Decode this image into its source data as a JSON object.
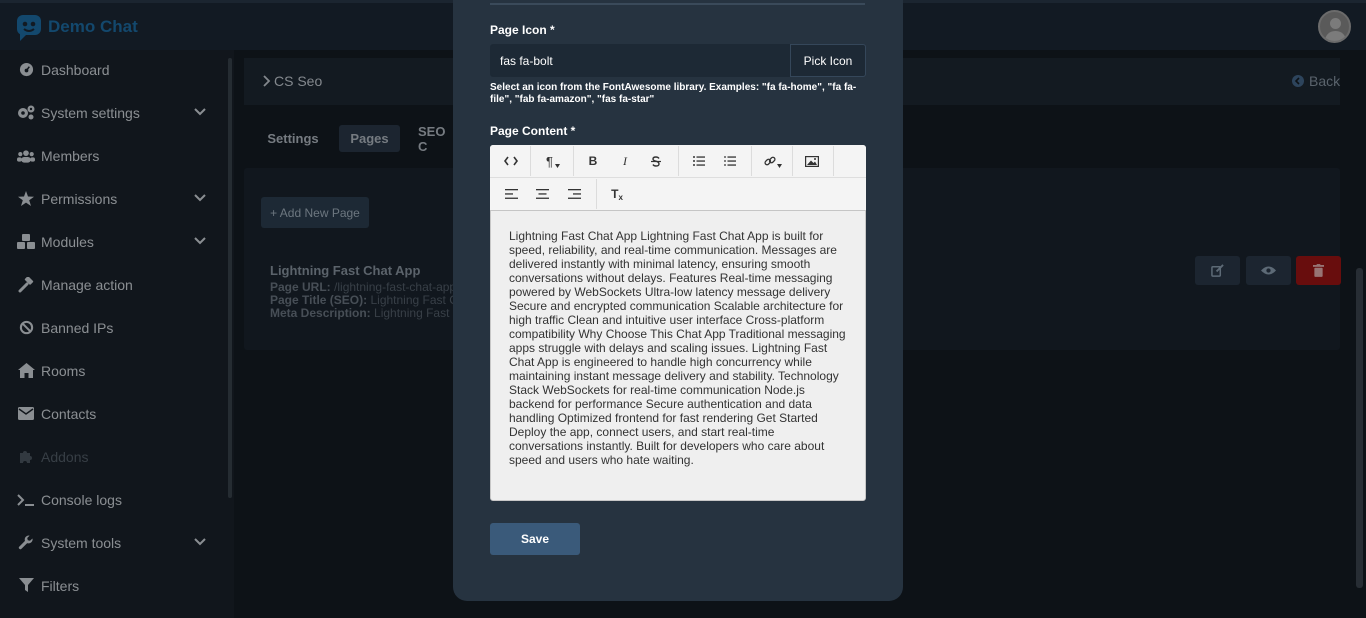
{
  "brand": {
    "name": "Demo Chat"
  },
  "sidebar": {
    "items": [
      {
        "label": "Dashboard",
        "icon": "dashboard-icon",
        "chevron": false,
        "dim": false
      },
      {
        "label": "System settings",
        "icon": "gears-icon",
        "chevron": true,
        "dim": false
      },
      {
        "label": "Members",
        "icon": "users-icon",
        "chevron": false,
        "dim": false
      },
      {
        "label": "Permissions",
        "icon": "star-icon",
        "chevron": true,
        "dim": false
      },
      {
        "label": "Modules",
        "icon": "cubes-icon",
        "chevron": true,
        "dim": false
      },
      {
        "label": "Manage action",
        "icon": "hammer-icon",
        "chevron": false,
        "dim": false
      },
      {
        "label": "Banned IPs",
        "icon": "ban-icon",
        "chevron": false,
        "dim": false
      },
      {
        "label": "Rooms",
        "icon": "home-icon",
        "chevron": false,
        "dim": false
      },
      {
        "label": "Contacts",
        "icon": "envelope-icon",
        "chevron": false,
        "dim": false
      },
      {
        "label": "Addons",
        "icon": "puzzle-icon",
        "chevron": false,
        "dim": true
      },
      {
        "label": "Console logs",
        "icon": "terminal-icon",
        "chevron": false,
        "dim": false
      },
      {
        "label": "System tools",
        "icon": "wrench-icon",
        "chevron": true,
        "dim": false
      },
      {
        "label": "Filters",
        "icon": "filter-icon",
        "chevron": false,
        "dim": false
      }
    ]
  },
  "header": {
    "breadcrumb": "CS Seo",
    "back_label": "Back"
  },
  "tabs": [
    {
      "label": "Settings",
      "active": false
    },
    {
      "label": "Pages",
      "active": true
    },
    {
      "label": "SEO C",
      "active": false
    }
  ],
  "pages_list": {
    "add_button": "+ Add New Page",
    "item": {
      "title": "Lightning Fast Chat App",
      "url_label": "Page URL:",
      "url_value": "/lightning-fast-chat-app",
      "seo_title_label": "Page Title (SEO):",
      "seo_title_value": "Lightning Fast C",
      "meta_label": "Meta Description:",
      "meta_value": "Lightning Fast C"
    },
    "colors": {
      "edit": "#2b3a4b",
      "view": "#2b3a4b",
      "delete": "#a01414"
    }
  },
  "modal": {
    "icon_label": "Page Icon *",
    "icon_value": "fas fa-bolt",
    "pick_icon_label": "Pick Icon",
    "icon_help": "Select an icon from the FontAwesome library. Examples: \"fa fa-home\", \"fa fa-file\", \"fab fa-amazon\", \"fas fa-star\"",
    "content_label": "Page Content *",
    "content_text": "Lightning Fast Chat App Lightning Fast Chat App is built for speed, reliability, and real-time communication. Messages are delivered instantly with minimal latency, ensuring smooth conversations without delays. Features Real-time messaging powered by WebSockets Ultra-low latency message delivery Secure and encrypted communication Scalable architecture for high traffic Clean and intuitive user interface Cross-platform compatibility Why Choose This Chat App Traditional messaging apps struggle with delays and scaling issues. Lightning Fast Chat App is engineered to handle high concurrency while maintaining instant message delivery and stability. Technology Stack WebSockets for real-time communication Node.js backend for performance Secure authentication and data handling Optimized frontend for fast rendering Get Started Deploy the app, connect users, and start real-time conversations instantly. Built for developers who care about speed and users who hate waiting.",
    "save_label": "Save",
    "toolbar": {
      "row1": [
        "code-view-icon",
        "paragraph-icon",
        "bold-icon",
        "italic-icon",
        "strikethrough-icon",
        "bullet-list-icon",
        "numbered-list-icon",
        "link-icon",
        "image-icon"
      ],
      "row2": [
        "align-left-icon",
        "align-center-icon",
        "align-right-icon",
        "clear-format-icon"
      ],
      "glyphs": {
        "paragraph": "¶",
        "bold": "B",
        "italic": "I",
        "clear": "T"
      }
    }
  }
}
